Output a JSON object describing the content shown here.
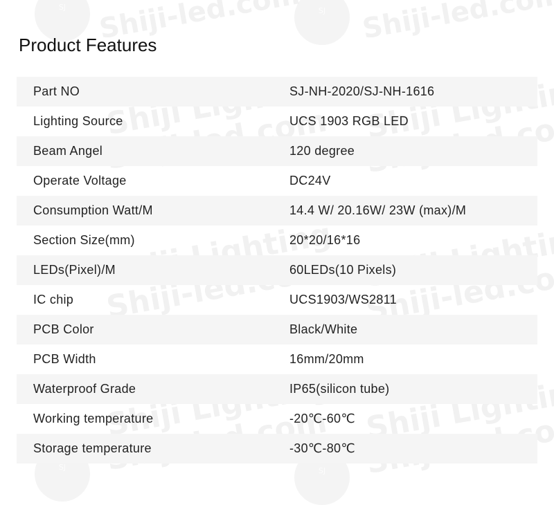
{
  "page_title": "Product Features",
  "features": [
    {
      "label": "Part NO",
      "value": "SJ-NH-2020/SJ-NH-1616"
    },
    {
      "label": "Lighting Source",
      "value": "UCS 1903 RGB LED"
    },
    {
      "label": "Beam Angel",
      "value": "120 degree"
    },
    {
      "label": "Operate Voltage",
      "value": "DC24V"
    },
    {
      "label": "Consumption Watt/M",
      "value": "14.4 W/ 20.16W/  23W  (max)/M"
    },
    {
      "label": "Section Size(mm)",
      "value": "20*20/16*16"
    },
    {
      "label": "LEDs(Pixel)/M",
      "value": "60LEDs(10 Pixels)"
    },
    {
      "label": "IC chip",
      "value": "UCS1903/WS2811"
    },
    {
      "label": "PCB Color",
      "value": "Black/White"
    },
    {
      "label": "PCB Width",
      "value": "16mm/20mm"
    },
    {
      "label": "Waterproof Grade",
      "value": "IP65(silicon tube)"
    },
    {
      "label": "Working temperature",
      "value": "-20℃-60℃"
    },
    {
      "label": "Storage temperature",
      "value": "-30℃-80℃"
    }
  ],
  "watermark": {
    "brand": "Shiji Lighting",
    "site": "Shiji-led.com",
    "logo_text": "SJ",
    "color": "#9e9e9e"
  },
  "colors": {
    "shaded_row": "#f5f5f5",
    "text": "#222222"
  }
}
